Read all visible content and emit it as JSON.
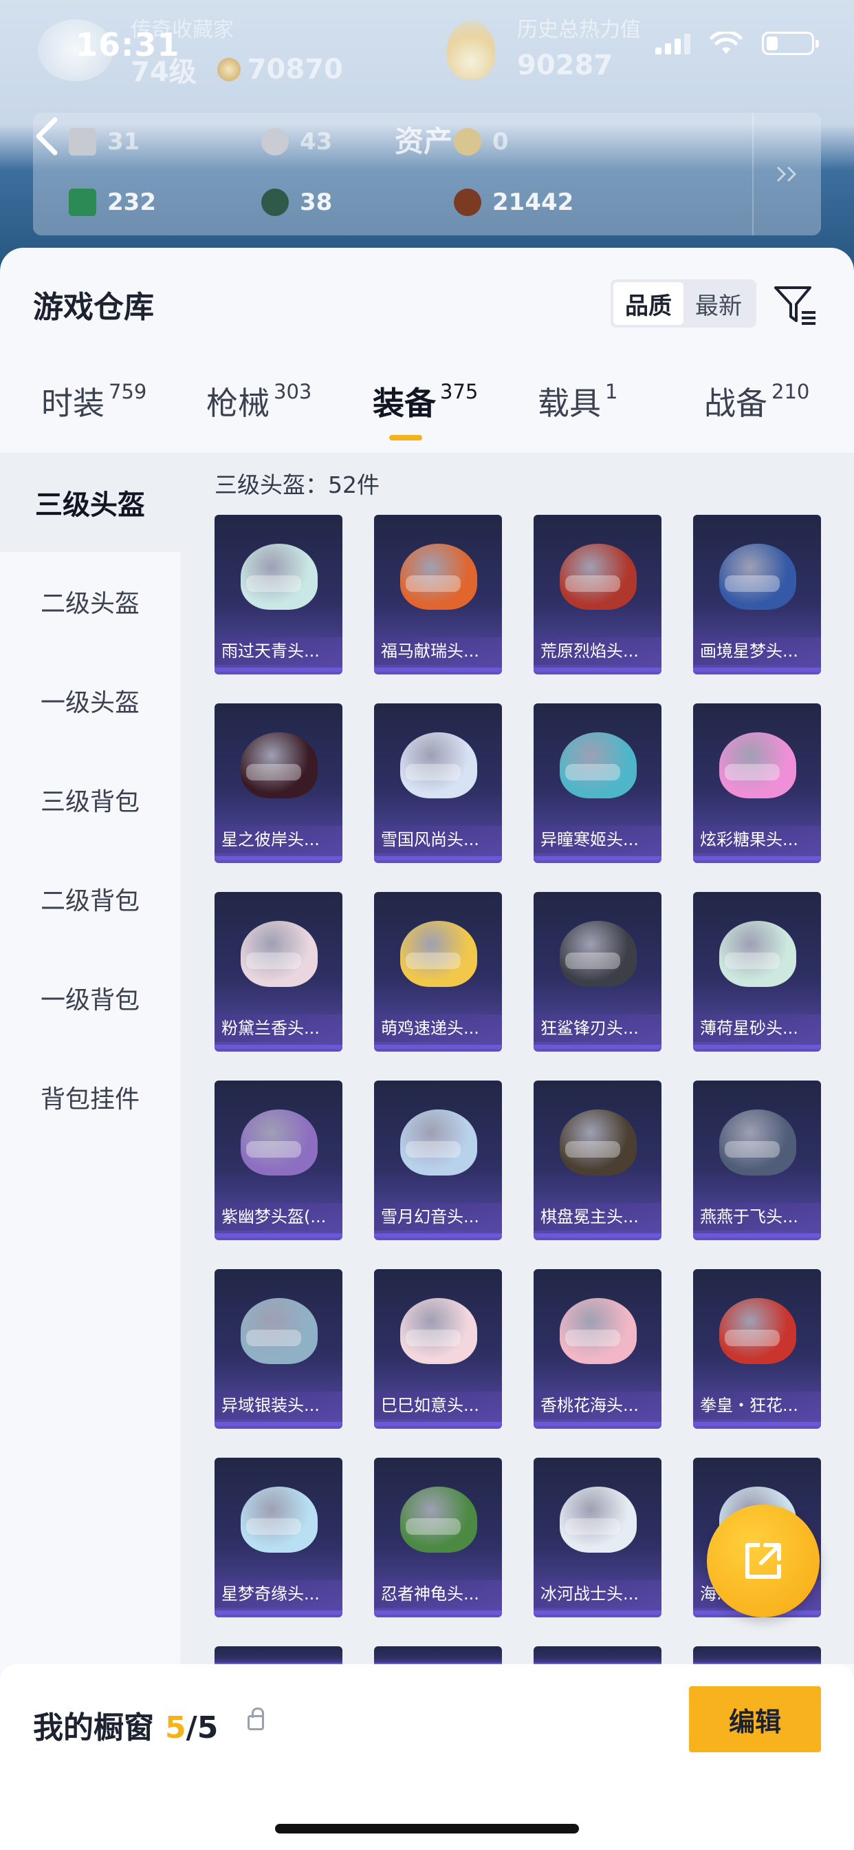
{
  "status_bar": {
    "time": "16:31"
  },
  "profile": {
    "title": "传奇收藏家",
    "level": "74级",
    "coins": "70870",
    "hot_title": "历史总热力值",
    "hot_value": "90287"
  },
  "assets": {
    "title": "资产",
    "row1": [
      "31",
      "43",
      "0"
    ],
    "row2": [
      "232",
      "38",
      "21442"
    ]
  },
  "warehouse": {
    "title": "游戏仓库",
    "sort": {
      "quality": "品质",
      "newest": "最新"
    },
    "tabs": [
      {
        "label": "时装",
        "count": "759"
      },
      {
        "label": "枪械",
        "count": "303"
      },
      {
        "label": "装备",
        "count": "375"
      },
      {
        "label": "载具",
        "count": "1"
      },
      {
        "label": "战备",
        "count": "210"
      }
    ],
    "categories": [
      "三级头盔",
      "二级头盔",
      "一级头盔",
      "三级背包",
      "二级背包",
      "一级背包",
      "背包挂件"
    ],
    "grid_title": "三级头盔：52件",
    "items": [
      {
        "label": "雨过天青头...",
        "color": "#c9e7e4"
      },
      {
        "label": "福马献瑞头...",
        "color": "#e0662e"
      },
      {
        "label": "荒原烈焰头...",
        "color": "#b0372b"
      },
      {
        "label": "画境星梦头...",
        "color": "#3459a6"
      },
      {
        "label": "星之彼岸头...",
        "color": "#3a1a24"
      },
      {
        "label": "雪国风尚头...",
        "color": "#d7e2f4"
      },
      {
        "label": "异瞳寒姬头...",
        "color": "#4fb6c9"
      },
      {
        "label": "炫彩糖果头...",
        "color": "#ef8fd7"
      },
      {
        "label": "粉黛兰香头...",
        "color": "#e9d6de"
      },
      {
        "label": "萌鸡速递头...",
        "color": "#f2c84a"
      },
      {
        "label": "狂鲨锋刃头...",
        "color": "#3c3f47"
      },
      {
        "label": "薄荷星砂头...",
        "color": "#cde9df"
      },
      {
        "label": "紫幽梦头盔(...",
        "color": "#8d6fc2"
      },
      {
        "label": "雪月幻音头...",
        "color": "#b9d2ec"
      },
      {
        "label": "棋盘冕主头...",
        "color": "#4a3f31"
      },
      {
        "label": "燕燕于飞头...",
        "color": "#4f5d78"
      },
      {
        "label": "异域银装头...",
        "color": "#8fb1c6"
      },
      {
        "label": "巳巳如意头...",
        "color": "#f3d7dd"
      },
      {
        "label": "香桃花海头...",
        "color": "#f2b7c6"
      },
      {
        "label": "拳皇・狂花...",
        "color": "#c9342c"
      },
      {
        "label": "星梦奇缘头...",
        "color": "#b8dff2"
      },
      {
        "label": "忍者神龟头...",
        "color": "#4c8a43"
      },
      {
        "label": "冰河战士头...",
        "color": "#e6ecf3"
      },
      {
        "label": "海...",
        "color": "#cfe3ef"
      }
    ]
  },
  "showcase": {
    "label": "我的橱窗",
    "count": "5",
    "total": "/5",
    "edit": "编辑"
  }
}
